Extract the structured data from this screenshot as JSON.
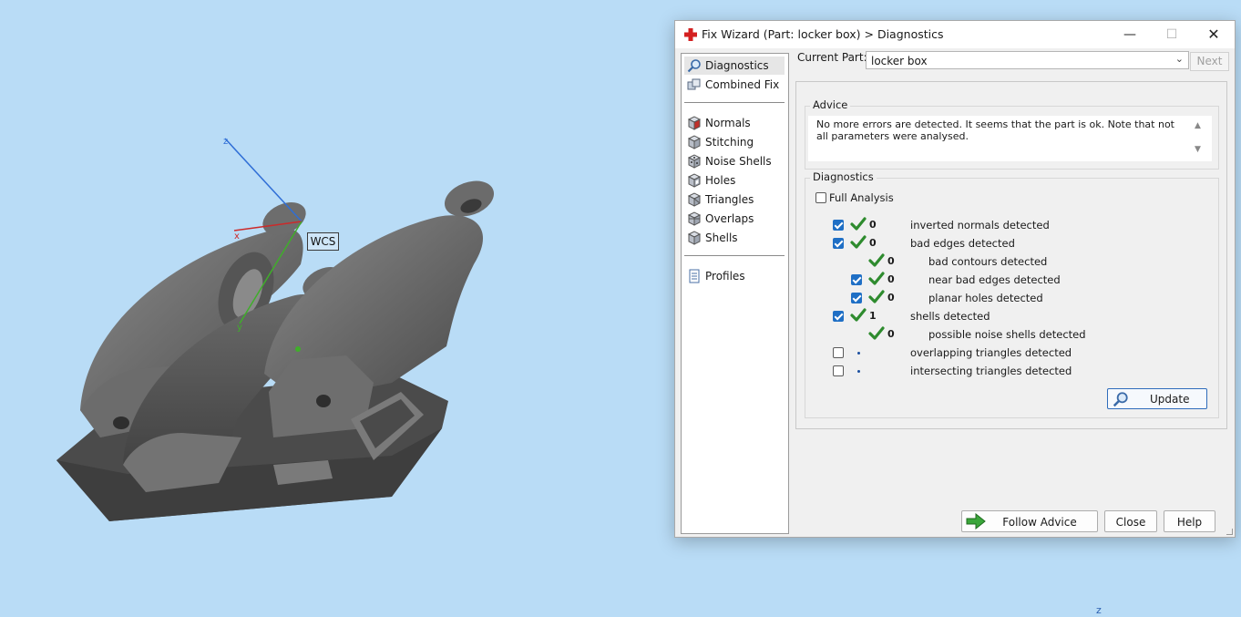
{
  "viewport": {
    "wcs_label": "WCS",
    "axis_x": "x",
    "axis_y": "y",
    "axis_z": "z",
    "corner_axis": "z",
    "colors": {
      "background": "#b9dcf6",
      "model": "#5e5e5e",
      "axis_x": "#cc2a2a",
      "axis_y": "#3fae2a",
      "axis_z": "#2f6ed6"
    }
  },
  "window": {
    "title": "Fix Wizard (Part: locker box) > Diagnostics",
    "title_icon": "red-cross-icon",
    "minimize_glyph": "—",
    "maximize_glyph": "☐",
    "close_glyph": "✕"
  },
  "nav": {
    "group1": [
      {
        "label": "Diagnostics",
        "icon": "magnifier-icon",
        "selected": true
      },
      {
        "label": "Combined Fix",
        "icon": "cubes-icon",
        "selected": false
      }
    ],
    "group2": [
      {
        "label": "Normals",
        "icon": "normals-cube-icon"
      },
      {
        "label": "Stitching",
        "icon": "stitching-cube-icon"
      },
      {
        "label": "Noise Shells",
        "icon": "noise-shells-icon"
      },
      {
        "label": "Holes",
        "icon": "holes-cube-icon"
      },
      {
        "label": "Triangles",
        "icon": "triangles-cube-icon"
      },
      {
        "label": "Overlaps",
        "icon": "overlaps-cube-icon"
      },
      {
        "label": "Shells",
        "icon": "shells-cube-icon"
      }
    ],
    "group3": [
      {
        "label": "Profiles",
        "icon": "document-icon"
      }
    ]
  },
  "current_part": {
    "label": "Current Part:",
    "value": "locker box",
    "next_label": "Next"
  },
  "advice": {
    "title": "Advice",
    "text": "No more errors are detected. It seems that the part is ok. Note that not all parameters were analysed.",
    "scroll_up": "▲",
    "scroll_down": "▼"
  },
  "diagnostics": {
    "title": "Diagnostics",
    "full_analysis_label": "Full Analysis",
    "full_analysis_checked": false,
    "rows": [
      {
        "checkbox": "checked",
        "status": "check",
        "count": "0",
        "text": "inverted normals detected",
        "indent": 0
      },
      {
        "checkbox": "checked",
        "status": "check",
        "count": "0",
        "text": "bad edges detected",
        "indent": 0
      },
      {
        "checkbox": "none",
        "status": "check",
        "count": "0",
        "text": "bad contours detected",
        "indent": 1
      },
      {
        "checkbox": "checked",
        "status": "check",
        "count": "0",
        "text": "near bad edges detected",
        "indent": 1
      },
      {
        "checkbox": "checked",
        "status": "check",
        "count": "0",
        "text": "planar holes detected",
        "indent": 1
      },
      {
        "checkbox": "checked",
        "status": "check",
        "count": "1",
        "text": "shells detected",
        "indent": 0
      },
      {
        "checkbox": "none",
        "status": "check",
        "count": "0",
        "text": "possible noise shells detected",
        "indent": 1
      },
      {
        "checkbox": "unchecked",
        "status": "dot",
        "count": "",
        "text": "overlapping triangles detected",
        "indent": 0
      },
      {
        "checkbox": "unchecked",
        "status": "dot",
        "count": "",
        "text": "intersecting triangles detected",
        "indent": 0
      }
    ],
    "update_label": "Update"
  },
  "buttons": {
    "follow_advice": "Follow Advice",
    "close": "Close",
    "help": "Help"
  },
  "accent_colors": {
    "checkbox": "#1f6fc5",
    "checkmark": "#2e8b2e",
    "arrow": "#3aa63a"
  }
}
